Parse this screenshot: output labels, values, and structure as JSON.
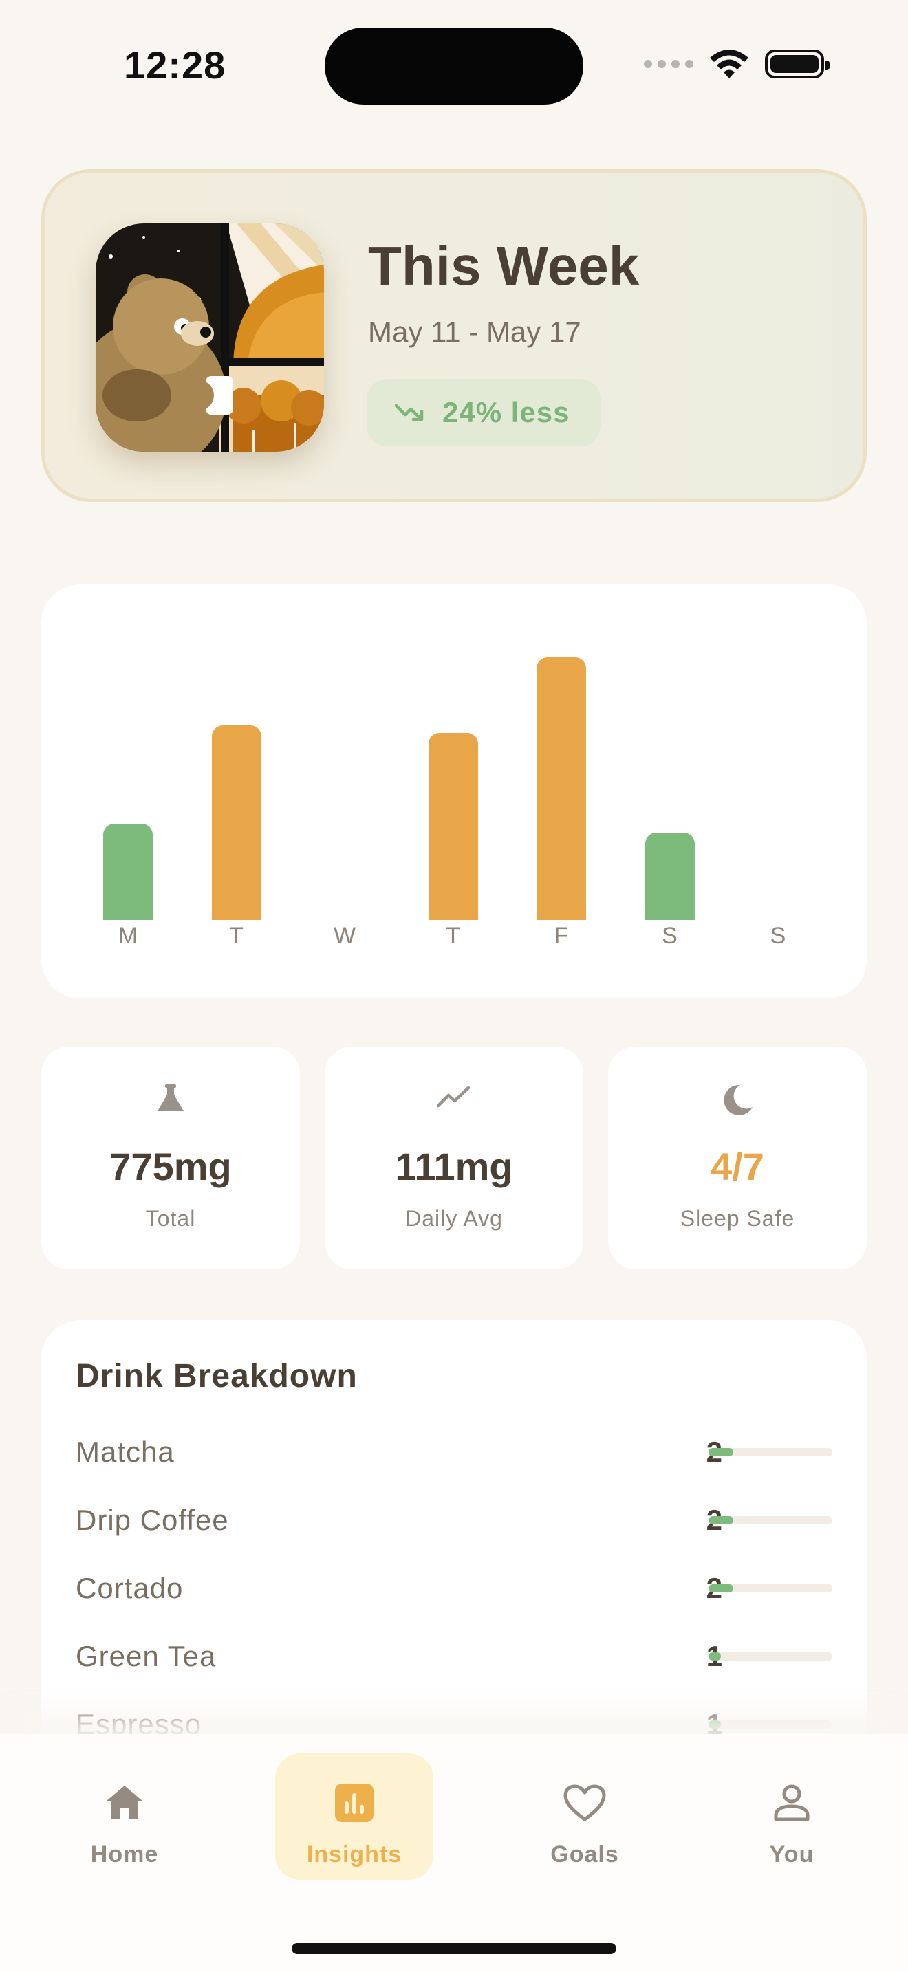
{
  "status_bar": {
    "time": "12:28"
  },
  "hero": {
    "title": "This Week",
    "date_range": "May 11 - May 17",
    "trend_label": "24% less",
    "trend_color": "#7cb47a"
  },
  "chart_data": {
    "type": "bar",
    "categories": [
      "M",
      "T",
      "W",
      "T",
      "F",
      "S",
      "S"
    ],
    "values": [
      75,
      152,
      0,
      146,
      205,
      68,
      0
    ],
    "colors": [
      "#7cbb7c",
      "#e8a648",
      "#e8a648",
      "#e8a648",
      "#e8a648",
      "#7cbb7c",
      "#7cbb7c"
    ],
    "ylim": [
      0,
      220
    ],
    "grid": false
  },
  "stats": [
    {
      "icon": "flask-icon",
      "value": "775mg",
      "label": "Total",
      "value_color": "#4a3f35"
    },
    {
      "icon": "trend-line-icon",
      "value": "111mg",
      "label": "Daily Avg",
      "value_color": "#4a3f35"
    },
    {
      "icon": "moon-icon",
      "value": "4/7",
      "label": "Sleep Safe",
      "value_color": "#e8a648"
    }
  ],
  "breakdown": {
    "title": "Drink Breakdown",
    "items": [
      {
        "name": "Matcha",
        "count": "2",
        "fraction": 0.2
      },
      {
        "name": "Drip Coffee",
        "count": "2",
        "fraction": 0.2
      },
      {
        "name": "Cortado",
        "count": "2",
        "fraction": 0.2
      },
      {
        "name": "Green Tea",
        "count": "1",
        "fraction": 0.1
      },
      {
        "name": "Espresso",
        "count": "1",
        "fraction": 0.1
      }
    ]
  },
  "tabs": [
    {
      "label": "Home",
      "icon": "home-icon",
      "active": false
    },
    {
      "label": "Insights",
      "icon": "chart-icon",
      "active": true
    },
    {
      "label": "Goals",
      "icon": "heart-icon",
      "active": false
    },
    {
      "label": "You",
      "icon": "person-icon",
      "active": false
    }
  ],
  "colors": {
    "accent": "#e8a648",
    "positive": "#7cbb7c",
    "background": "#f9f6f1"
  }
}
